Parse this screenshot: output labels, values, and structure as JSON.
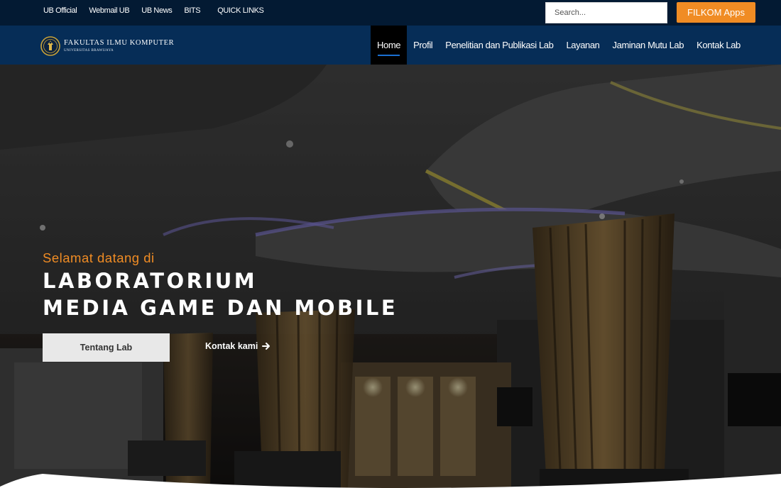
{
  "topbar": {
    "links": [
      "UB Official",
      "Webmail UB",
      "UB News",
      "BITS",
      "QUICK LINKS"
    ],
    "search_placeholder": "Search...",
    "apps_button": "FILKOM Apps"
  },
  "brand": {
    "title": "Fakultas Ilmu Komputer",
    "subtitle": "Universitas Brawijaya",
    "logo_icon": "ub-crest-icon"
  },
  "nav": {
    "items": [
      {
        "label": "Home",
        "active": true
      },
      {
        "label": "Profil"
      },
      {
        "label": "Penelitian dan Publikasi Lab"
      },
      {
        "label": "Layanan"
      },
      {
        "label": "Jaminan Mutu Lab"
      },
      {
        "label": "Kontak Lab"
      }
    ]
  },
  "hero": {
    "greeting": "Selamat datang di",
    "title_line1": "LABORATORIUM",
    "title_line2": "MEDIA GAME DAN MOBILE",
    "primary_button": "Tentang Lab",
    "secondary_link": "Kontak kami",
    "secondary_icon": "arrow-right-icon"
  },
  "colors": {
    "topbar_bg": "#031a33",
    "nav_bg": "#062d57",
    "accent_orange": "#f08c24",
    "active_underline": "#1a6fd1"
  }
}
